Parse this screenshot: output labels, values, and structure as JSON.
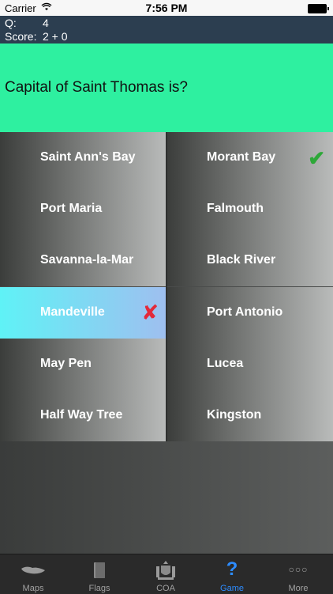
{
  "status_bar": {
    "carrier": "Carrier",
    "time": "7:56 PM"
  },
  "info": {
    "q_label": "Q:",
    "q_value": "4",
    "score_label": "Score:",
    "score_value": "2 + 0"
  },
  "question": "Capital of Saint Thomas is?",
  "answers": {
    "left": [
      "Saint Ann's Bay",
      "Port Maria",
      "Savanna-la-Mar",
      "Mandeville",
      "May Pen",
      "Half Way Tree"
    ],
    "right": [
      "Morant Bay",
      "Falmouth",
      "Black River",
      "Port Antonio",
      "Lucea",
      "Kingston"
    ]
  },
  "marks": {
    "correct": "✔",
    "wrong": "✘"
  },
  "tabs": [
    {
      "label": "Maps",
      "icon": "map-icon"
    },
    {
      "label": "Flags",
      "icon": "flag-icon"
    },
    {
      "label": "COA",
      "icon": "coat-of-arms-icon"
    },
    {
      "label": "Game",
      "icon": "question-mark-icon",
      "glyph": "?"
    },
    {
      "label": "More",
      "icon": "more-icon",
      "glyph": "○○○"
    }
  ],
  "colors": {
    "accent": "#2d8cff",
    "question_bg": "#2ef0a0",
    "wrong_bg": "#5ff2f6",
    "correct_mark": "#2da838",
    "wrong_mark": "#e32a3a"
  }
}
